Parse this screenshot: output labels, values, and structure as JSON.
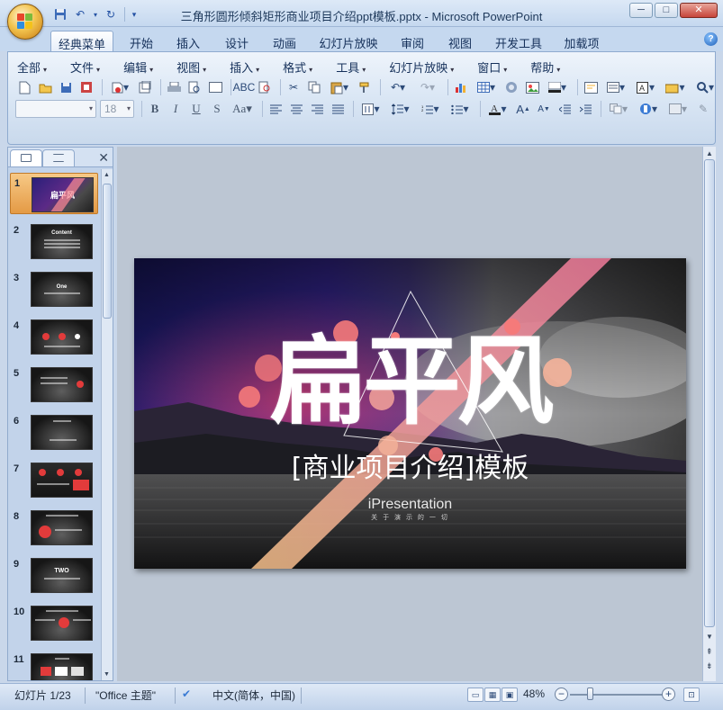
{
  "window": {
    "title": "三角形圆形倾斜矩形商业项目介绍ppt模板.pptx - Microsoft PowerPoint",
    "minimize": "─",
    "maximize": "□",
    "close": "✕"
  },
  "quick_access": [
    "save-icon",
    "undo-icon",
    "redo-icon",
    "customize-icon"
  ],
  "tabs": [
    {
      "label": "经典菜单",
      "active": true
    },
    {
      "label": "开始"
    },
    {
      "label": "插入"
    },
    {
      "label": "设计"
    },
    {
      "label": "动画"
    },
    {
      "label": "幻灯片放映"
    },
    {
      "label": "审阅"
    },
    {
      "label": "视图"
    },
    {
      "label": "开发工具"
    },
    {
      "label": "加载项"
    }
  ],
  "menu": [
    "全部",
    "文件",
    "编辑",
    "视图",
    "插入",
    "格式",
    "工具",
    "幻灯片放映",
    "窗口",
    "帮助"
  ],
  "font": {
    "name": "",
    "size": "18"
  },
  "format_buttons": [
    "B",
    "I",
    "U",
    "S",
    "Aa"
  ],
  "slides": [
    {
      "num": "1",
      "label": "扁平风",
      "selected": true
    },
    {
      "num": "2",
      "label": "Content"
    },
    {
      "num": "3",
      "label": "One"
    },
    {
      "num": "4",
      "label": ""
    },
    {
      "num": "5",
      "label": ""
    },
    {
      "num": "6",
      "label": ""
    },
    {
      "num": "7",
      "label": ""
    },
    {
      "num": "8",
      "label": ""
    },
    {
      "num": "9",
      "label": "TWO"
    },
    {
      "num": "10",
      "label": ""
    },
    {
      "num": "11",
      "label": ""
    }
  ],
  "slide": {
    "main_title": "扁平风",
    "subtitle": "[商业项目介绍]模板",
    "brand": "iPresentation",
    "tagline": "关 于 演 示 的 一 切"
  },
  "status": {
    "slide_info": "幻灯片 1/23",
    "theme": "\"Office 主题\"",
    "language": "中文(简体，中国)",
    "zoom": "48%",
    "zoom_level": 48
  },
  "colors": {
    "accent_pink": "#f07a86",
    "accent_peach": "#f5b39a",
    "sky_purple": "#3a2aa0",
    "selection_orange": "#e49a45"
  }
}
